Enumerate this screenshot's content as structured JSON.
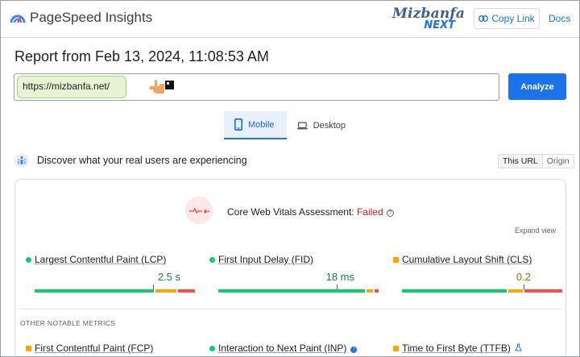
{
  "header": {
    "app_title": "PageSpeed Insights",
    "brand_line1": "Mizbanfa",
    "brand_line2": "NEXT",
    "copy_link_label": "Copy Link",
    "docs_label": "Docs"
  },
  "report": {
    "title": "Report from Feb 13, 2024, 11:08:53 AM",
    "url_value": "https://mizbanfa.net/",
    "analyze_label": "Analyze"
  },
  "tabs": [
    {
      "label": "Mobile",
      "icon": "phone-icon",
      "selected": true
    },
    {
      "label": "Desktop",
      "icon": "laptop-icon",
      "selected": false
    }
  ],
  "field_data": {
    "discover_text": "Discover what your real users are experiencing",
    "toggle": [
      "This URL",
      "Origin"
    ],
    "assessment_label": "Core Web Vitals Assessment: ",
    "assessment_status": "Failed",
    "expand_view": "Expand view",
    "metrics": [
      {
        "name": "Largest Contentful Paint (LCP)",
        "value": "2.5 s",
        "status": "good",
        "status_color": "#0cce6b"
      },
      {
        "name": "First Input Delay (FID)",
        "value": "18 ms",
        "status": "good",
        "status_color": "#0cce6b"
      },
      {
        "name": "Cumulative Layout Shift (CLS)",
        "value": "0.2",
        "status": "needs-improvement",
        "status_color": "#ffa400"
      }
    ],
    "other_label": "OTHER NOTABLE METRICS",
    "other_metrics": [
      {
        "name": "First Contentful Paint (FCP)",
        "status": "needs-improvement"
      },
      {
        "name": "Interaction to Next Paint (INP)",
        "status": "good",
        "info": "i"
      },
      {
        "name": "Time to First Byte (TTFB)",
        "status": "needs-improvement"
      }
    ]
  },
  "colors": {
    "accent": "#1a73e8",
    "good": "#0cce6b",
    "average": "#ffa400",
    "poor": "#ff4e42",
    "failed_text": "#c5221f"
  }
}
